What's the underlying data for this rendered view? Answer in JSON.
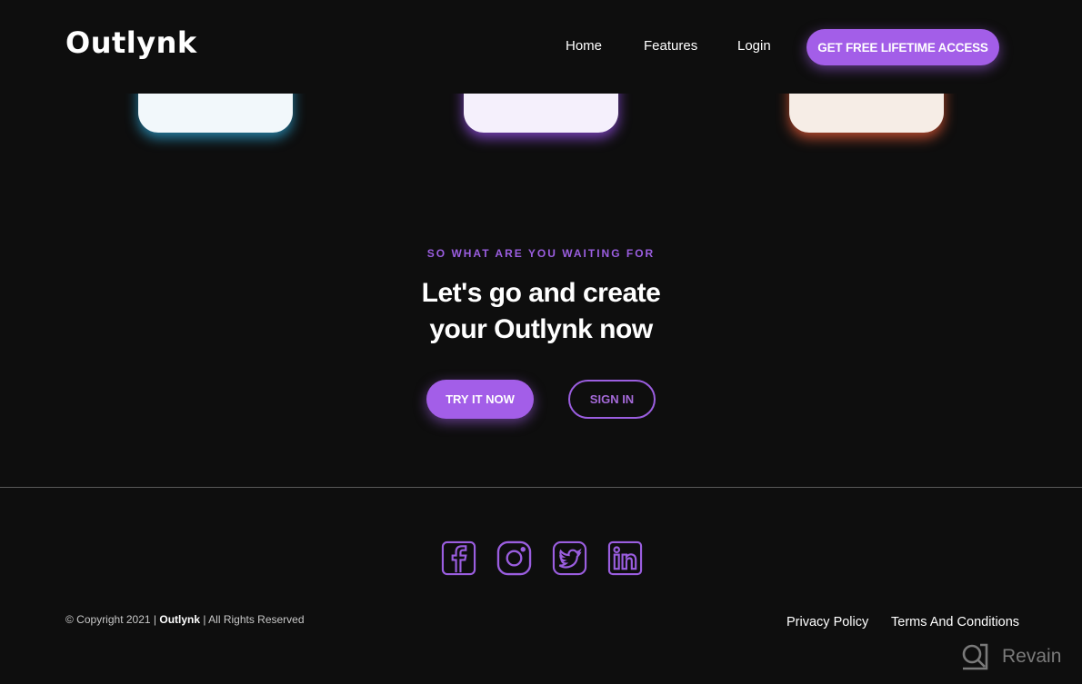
{
  "header": {
    "logo": "Outlynk",
    "nav": [
      {
        "label": "Home"
      },
      {
        "label": "Features"
      },
      {
        "label": "Login"
      }
    ],
    "cta_label": "GET FREE LIFETIME ACCESS"
  },
  "cards": [
    {
      "accent": "#2a8cb4"
    },
    {
      "accent": "#8246c8"
    },
    {
      "accent": "#c85032"
    }
  ],
  "cta_section": {
    "eyebrow": "SO WHAT ARE YOU WAITING FOR",
    "headline_line1": "Let's go and create",
    "headline_line2": "your Outlynk now",
    "primary_button": "TRY IT NOW",
    "secondary_button": "SIGN IN"
  },
  "social": [
    {
      "name": "facebook-icon"
    },
    {
      "name": "instagram-icon"
    },
    {
      "name": "twitter-icon"
    },
    {
      "name": "linkedin-icon"
    }
  ],
  "footer": {
    "copyright_prefix": "© Copyright 2021 | ",
    "copyright_brand": "Outlynk",
    "copyright_suffix": " | All Rights Reserved",
    "links": [
      {
        "label": "Privacy Policy"
      },
      {
        "label": "Terms And Conditions"
      }
    ]
  },
  "watermark": {
    "label": "Revain"
  },
  "colors": {
    "accent": "#a35ee8",
    "background": "#0e0e0e"
  }
}
